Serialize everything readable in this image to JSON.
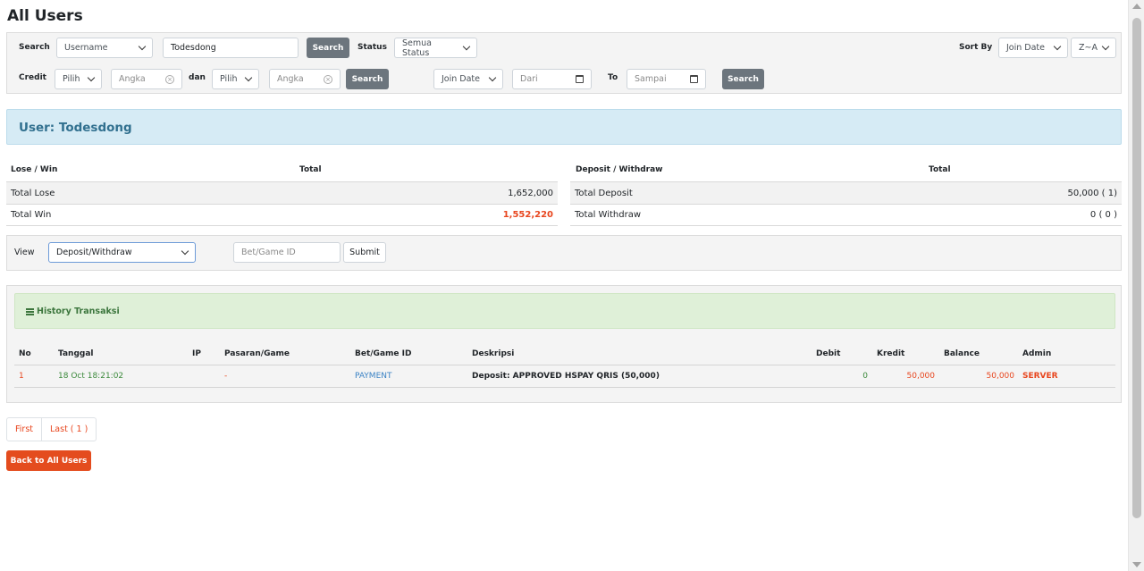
{
  "page": {
    "title": "All Users"
  },
  "filters": {
    "search_label": "Search",
    "search_field_value": "Username",
    "search_input_value": "Todesdong",
    "search_button": "Search",
    "status_label": "Status",
    "status_value": "Semua Status",
    "sort_label": "Sort By",
    "sort_value": "Join Date",
    "sort_order": "Z~A",
    "credit_label": "Credit",
    "credit_op1": "Pilih",
    "credit_amount1_placeholder": "Angka",
    "dan_label": "dan",
    "credit_op2": "Pilih",
    "credit_amount2_placeholder": "Angka",
    "credit_search_button": "Search",
    "date_field": "Join Date",
    "date_from_placeholder": "Dari",
    "to_label": "To",
    "date_to_placeholder": "Sampai",
    "date_search_button": "Search"
  },
  "user": {
    "banner": "User: Todesdong"
  },
  "summary": {
    "lose_win": {
      "header_label": "Lose / Win",
      "header_total": "Total",
      "rows": [
        {
          "label": "Total Lose",
          "value": "1,652,000"
        },
        {
          "label": "Total Win",
          "value": "1,552,220"
        }
      ]
    },
    "deposit_withdraw": {
      "header_label": "Deposit / Withdraw",
      "header_total": "Total",
      "rows": [
        {
          "label": "Total Deposit",
          "value": "50,000 ( 1)"
        },
        {
          "label": "Total Withdraw",
          "value": "0 ( 0 )"
        }
      ]
    }
  },
  "view": {
    "label": "View",
    "selected": "Deposit/Withdraw",
    "bet_id_placeholder": "Bet/Game ID",
    "submit": "Submit"
  },
  "history": {
    "title": "History Transaksi",
    "columns": [
      "No",
      "Tanggal",
      "IP",
      "Pasaran/Game",
      "Bet/Game ID",
      "Deskripsi",
      "Debit",
      "Kredit",
      "Balance",
      "Admin"
    ],
    "rows": [
      {
        "no": "1",
        "tanggal": "18 Oct 18:21:02",
        "ip": "",
        "pasaran": "-",
        "bet_id": "PAYMENT",
        "deskripsi": "Deposit: APPROVED HSPAY QRIS (50,000)",
        "debit": "0",
        "kredit": "50,000",
        "balance": "50,000",
        "admin": "SERVER"
      }
    ]
  },
  "pagination": {
    "first": "First",
    "last": "Last ( 1 )"
  },
  "back_button": "Back to All Users",
  "colors": {
    "accent": "#e44c1e",
    "info_bg": "#d6ebf5",
    "success_bg": "#dff0d8",
    "button_gray": "#6c757d"
  },
  "icons": {
    "history": "list-icon",
    "dropdown": "chevron-down-icon",
    "date": "calendar-icon",
    "clear": "clear-icon"
  }
}
